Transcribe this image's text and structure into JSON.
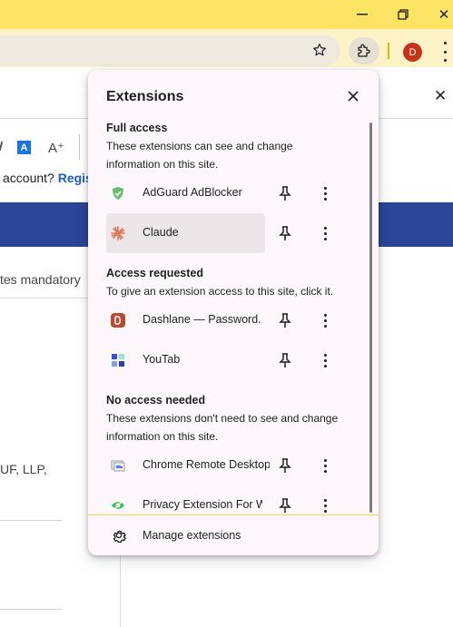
{
  "window": {
    "minimize_glyph": "✕",
    "restore_glyph": "▢",
    "close_glyph": "✕",
    "titlebar_color": "#fbe363"
  },
  "toolbar": {
    "bookmark_icon": "star-icon",
    "extensions_icon": "puzzle-icon",
    "profile_initial": "D",
    "profile_color": "#c4341b",
    "menu_icon": "vertical-dots-icon"
  },
  "page": {
    "close_glyph": "✕",
    "font_tool_a": "A",
    "font_tool_a_plus": "A⁺",
    "account_text": "account?",
    "register_text": "Regis",
    "mandatory_text": "tes mandatory",
    "llp_text": "UF, LLP,",
    "band_color": "#2b4597"
  },
  "popup": {
    "title": "Extensions",
    "close_label": "✕",
    "sections": [
      {
        "heading": "Full access",
        "description": "These extensions can see and change information on this site.",
        "items": [
          {
            "name": "AdGuard AdBlocker",
            "icon": "adguard-shield-icon"
          },
          {
            "name": "Claude",
            "icon": "claude-starburst-icon"
          }
        ]
      },
      {
        "heading": "Access requested",
        "description": "To give an extension access to this site, click it.",
        "items": [
          {
            "name": "Dashlane — Password...",
            "icon": "dashlane-icon"
          },
          {
            "name": "YouTab",
            "icon": "youtab-icon"
          }
        ]
      },
      {
        "heading": "No access needed",
        "description": "These extensions don't need to see and change information on this site.",
        "items": [
          {
            "name": "Chrome Remote Desktop",
            "icon": "remote-desktop-icon"
          },
          {
            "name": "Privacy Extension For W...",
            "icon": "privacy-eye-icon"
          }
        ]
      }
    ],
    "manage_label": "Manage extensions",
    "manage_icon": "gear-icon"
  }
}
